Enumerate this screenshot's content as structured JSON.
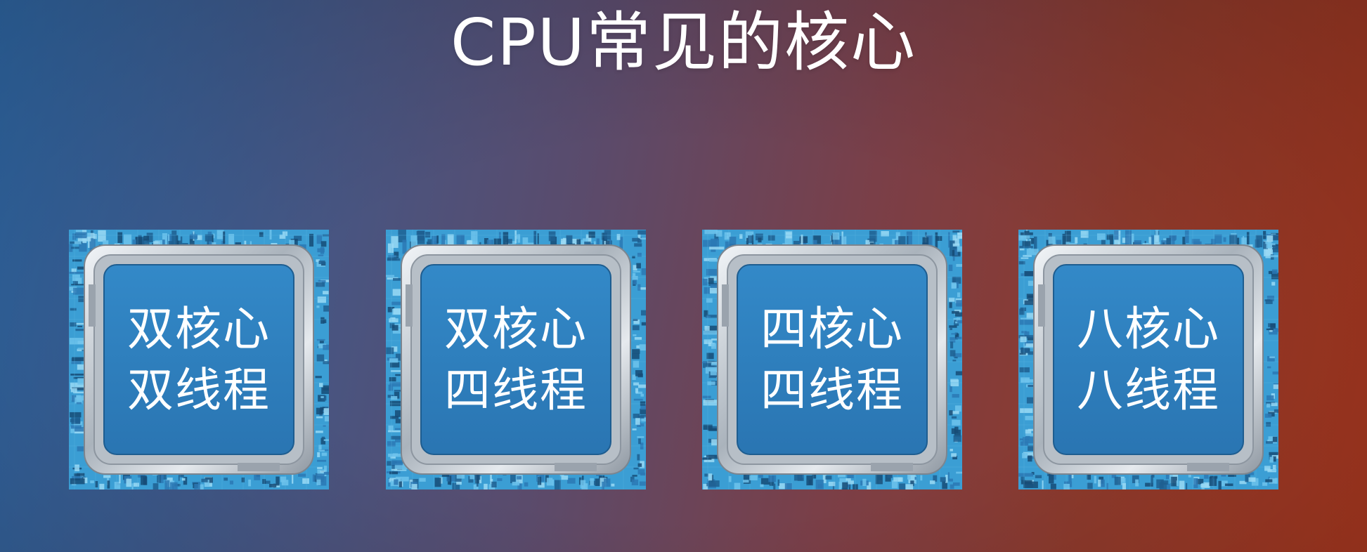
{
  "slide": {
    "title": "CPU常见的核心"
  },
  "chips": [
    {
      "line1": "双核心",
      "line2": "双线程"
    },
    {
      "line1": "双核心",
      "line2": "四线程"
    },
    {
      "line1": "四核心",
      "line2": "四线程"
    },
    {
      "line1": "八核心",
      "line2": "八线程"
    }
  ],
  "colors": {
    "chip_substrate": "#3b9ed4",
    "chip_face": "#2f80be",
    "chip_frame": "#c9d0d7",
    "title_text": "#ffffff"
  },
  "icons": {
    "chip": "cpu-chip-icon"
  }
}
